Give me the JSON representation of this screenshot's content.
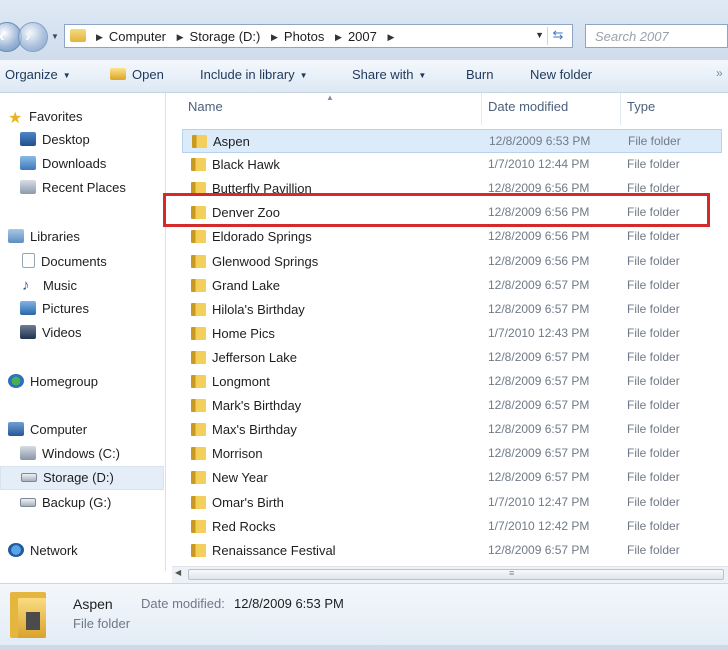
{
  "address": {
    "crumbs": [
      "Computer",
      "Storage (D:)",
      "Photos",
      "2007"
    ],
    "search_placeholder": "Search 2007"
  },
  "toolbar": {
    "organize": "Organize",
    "open": "Open",
    "include": "Include in library",
    "share": "Share with",
    "burn": "Burn",
    "new_folder": "New folder"
  },
  "nav": {
    "favorites": "Favorites",
    "desktop": "Desktop",
    "downloads": "Downloads",
    "recent": "Recent Places",
    "libraries": "Libraries",
    "documents": "Documents",
    "music": "Music",
    "pictures": "Pictures",
    "videos": "Videos",
    "homegroup": "Homegroup",
    "computer": "Computer",
    "windows": "Windows (C:)",
    "storage": "Storage (D:)",
    "backup": "Backup (G:)",
    "network": "Network"
  },
  "columns": {
    "name": "Name",
    "date": "Date modified",
    "type": "Type"
  },
  "rows": [
    {
      "name": "Aspen",
      "date": "12/8/2009 6:53 PM",
      "type": "File folder"
    },
    {
      "name": "Black Hawk",
      "date": "1/7/2010 12:44 PM",
      "type": "File folder"
    },
    {
      "name": "Butterfly Pavillion",
      "date": "12/8/2009 6:56 PM",
      "type": "File folder"
    },
    {
      "name": "Denver Zoo",
      "date": "12/8/2009 6:56 PM",
      "type": "File folder"
    },
    {
      "name": "Eldorado Springs",
      "date": "12/8/2009 6:56 PM",
      "type": "File folder"
    },
    {
      "name": "Glenwood Springs",
      "date": "12/8/2009 6:56 PM",
      "type": "File folder"
    },
    {
      "name": "Grand Lake",
      "date": "12/8/2009 6:57 PM",
      "type": "File folder"
    },
    {
      "name": "Hilola's Birthday",
      "date": "12/8/2009 6:57 PM",
      "type": "File folder"
    },
    {
      "name": "Home Pics",
      "date": "1/7/2010 12:43 PM",
      "type": "File folder"
    },
    {
      "name": "Jefferson Lake",
      "date": "12/8/2009 6:57 PM",
      "type": "File folder"
    },
    {
      "name": "Longmont",
      "date": "12/8/2009 6:57 PM",
      "type": "File folder"
    },
    {
      "name": "Mark's Birthday",
      "date": "12/8/2009 6:57 PM",
      "type": "File folder"
    },
    {
      "name": "Max's Birthday",
      "date": "12/8/2009 6:57 PM",
      "type": "File folder"
    },
    {
      "name": "Morrison",
      "date": "12/8/2009 6:57 PM",
      "type": "File folder"
    },
    {
      "name": "New Year",
      "date": "12/8/2009 6:57 PM",
      "type": "File folder"
    },
    {
      "name": "Omar's Birth",
      "date": "1/7/2010 12:47 PM",
      "type": "File folder"
    },
    {
      "name": "Red Rocks",
      "date": "1/7/2010 12:42 PM",
      "type": "File folder"
    },
    {
      "name": "Renaissance Festival",
      "date": "12/8/2009 6:57 PM",
      "type": "File folder"
    }
  ],
  "details": {
    "name": "Aspen",
    "type": "File folder",
    "date_label": "Date modified:",
    "date_value": "12/8/2009 6:53 PM"
  }
}
